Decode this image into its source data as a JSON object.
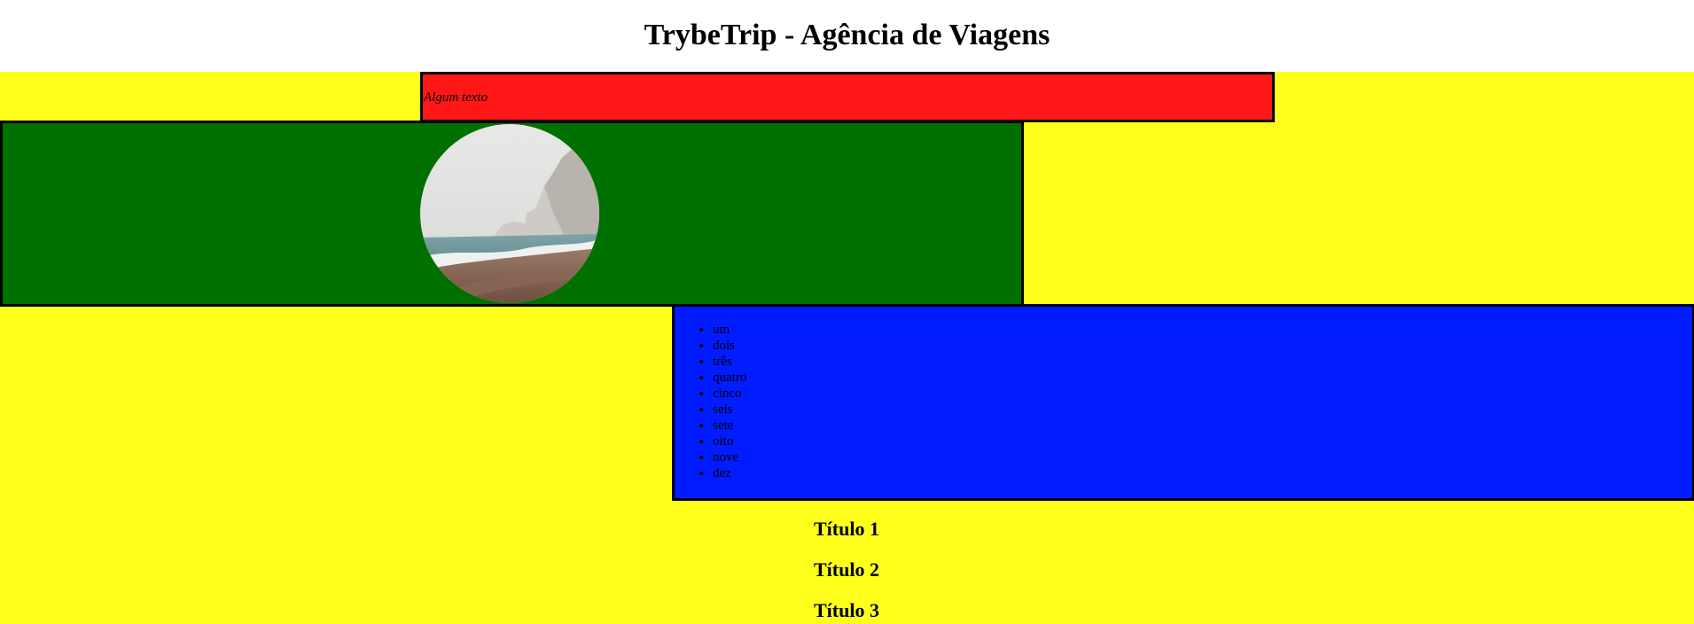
{
  "page": {
    "title": "TrybeTrip - Agência de Viagens"
  },
  "colors": {
    "background": "#ffffff",
    "area": "#ffff1c",
    "red_box": "#ff1717",
    "green_box": "#007000",
    "blue_box": "#001cff",
    "border": "#000000"
  },
  "red_box": {
    "text": "Algum texto"
  },
  "green_box": {
    "image": "beach-cliff-photo"
  },
  "list": {
    "items": [
      "um",
      "dois",
      "três",
      "quatro",
      "cinco",
      "seis",
      "sete",
      "oito",
      "nove",
      "dez"
    ]
  },
  "sections": [
    {
      "title": "Título 1"
    },
    {
      "title": "Título 2"
    },
    {
      "title": "Título 3"
    }
  ]
}
